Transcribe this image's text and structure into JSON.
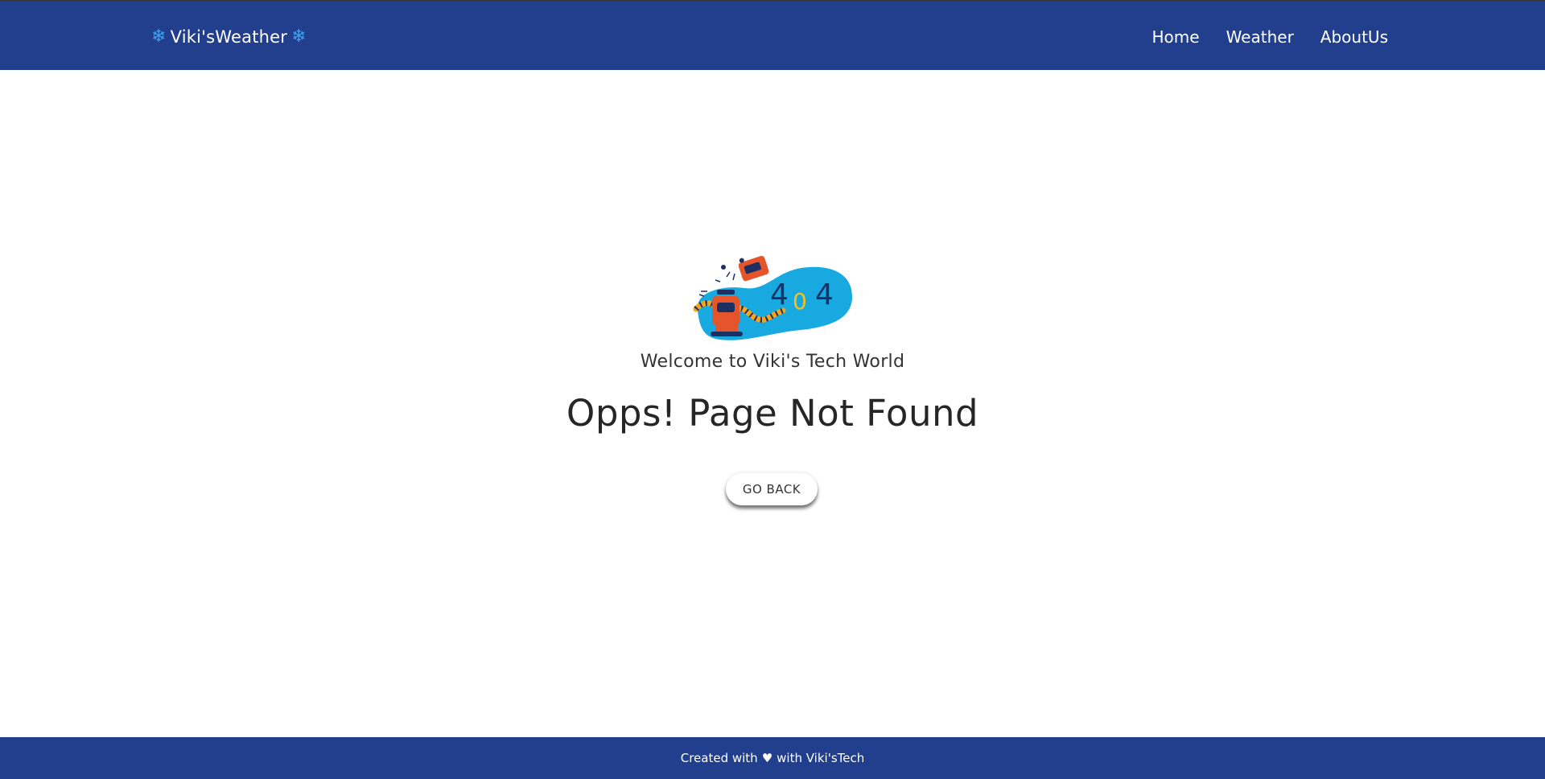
{
  "navbar": {
    "brand": "Viki'sWeather",
    "brand_icon": "snowflake-icon",
    "brand_icon_color": "#3aa6f2",
    "background": "#223f8d",
    "links": [
      {
        "label": "Home"
      },
      {
        "label": "Weather"
      },
      {
        "label": "AboutUs"
      }
    ]
  },
  "main": {
    "illustration": {
      "icon": "404-robot-illustration",
      "digits": [
        "4",
        "0",
        "4"
      ]
    },
    "welcome": "Welcome to Viki's Tech World",
    "headline": "Opps! Page Not Found",
    "go_back_label": "GO BACK"
  },
  "footer": {
    "before": "Created with",
    "heart_icon": "heart-icon",
    "after": "with Viki'sTech"
  }
}
